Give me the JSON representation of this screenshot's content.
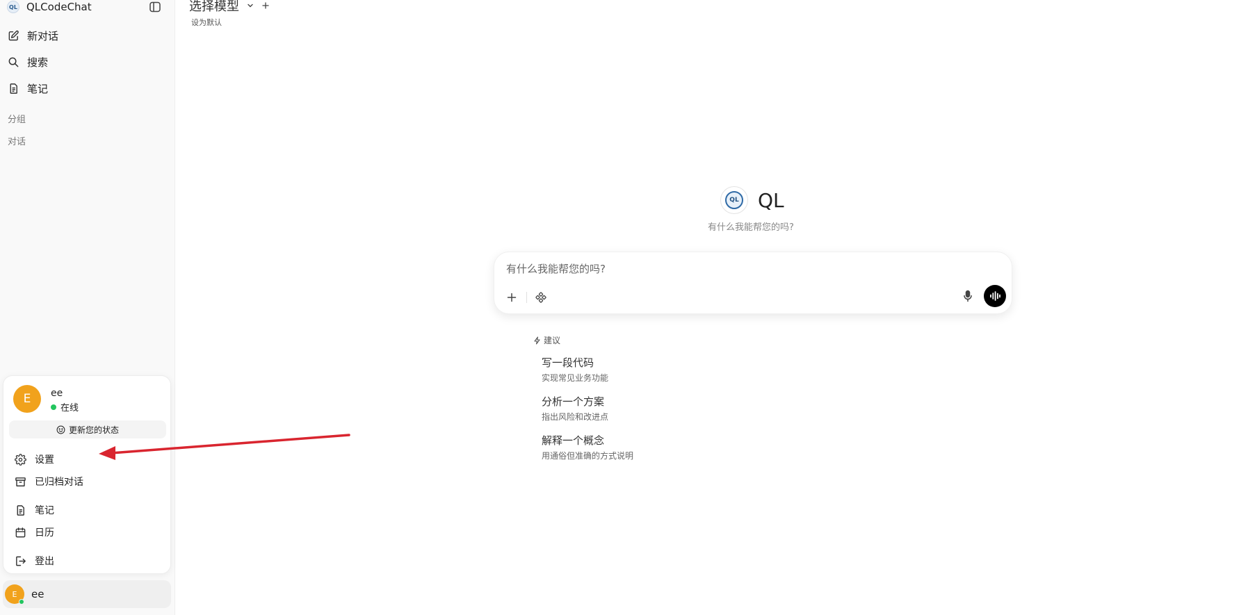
{
  "app": {
    "name": "QLCodeChat"
  },
  "sidebar": {
    "nav": [
      {
        "label": "新对话",
        "icon": "edit-icon"
      },
      {
        "label": "搜索",
        "icon": "search-icon"
      },
      {
        "label": "笔记",
        "icon": "notes-icon"
      }
    ],
    "sections": {
      "groups": "分组",
      "chats": "对话"
    }
  },
  "header": {
    "model_select": "选择模型",
    "set_default": "设为默认"
  },
  "hero": {
    "title": "QL",
    "subtitle": "有什么我能帮您的吗?"
  },
  "composer": {
    "placeholder": "有什么我能帮您的吗?"
  },
  "suggestions": {
    "header": "建议",
    "items": [
      {
        "title": "写一段代码",
        "desc": "实现常见业务功能"
      },
      {
        "title": "分析一个方案",
        "desc": "指出风险和改进点"
      },
      {
        "title": "解释一个概念",
        "desc": "用通俗但准确的方式说明"
      }
    ]
  },
  "user_menu": {
    "avatar_letter": "E",
    "name": "ee",
    "status": "在线",
    "update_status": "更新您的状态",
    "items": [
      {
        "label": "设置",
        "icon": "gear-icon"
      },
      {
        "label": "已归档对话",
        "icon": "archive-icon"
      },
      {
        "label": "笔记",
        "icon": "notes-icon"
      },
      {
        "label": "日历",
        "icon": "calendar-icon"
      },
      {
        "label": "登出",
        "icon": "logout-icon"
      }
    ]
  },
  "user_bar": {
    "avatar_letter": "E",
    "name": "ee"
  },
  "colors": {
    "avatar": "#f1a21c",
    "online": "#22c55e",
    "annotation_arrow": "#d9252f"
  }
}
